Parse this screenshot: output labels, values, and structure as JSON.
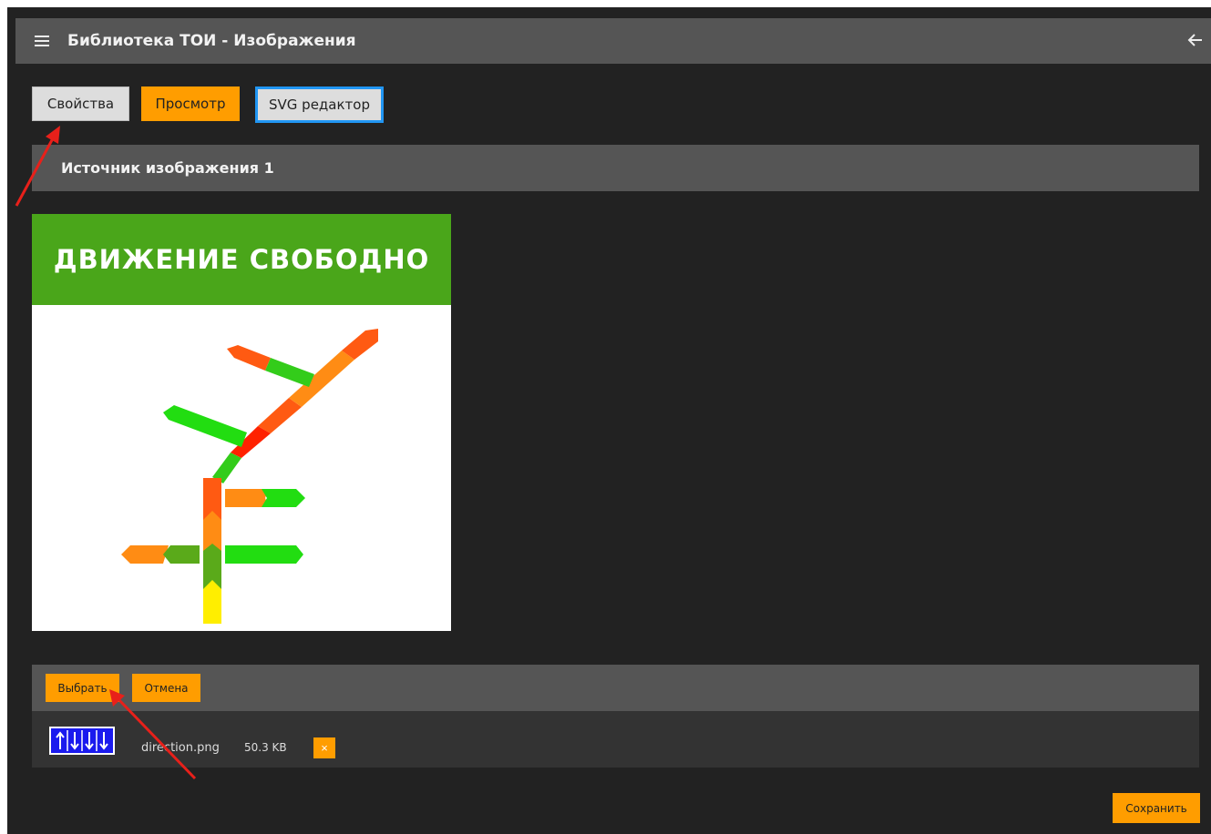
{
  "header": {
    "title": "Библиотека ТОИ - Изображения",
    "menu_icon": "hamburger-menu-icon",
    "back_icon": "arrow-left-icon"
  },
  "tabs": {
    "properties": "Свойства",
    "preview": "Просмотр",
    "svg_editor": "SVG редактор"
  },
  "section": {
    "title": "Источник изображения 1"
  },
  "image": {
    "banner_text": "ДВИЖЕНИЕ СВОБОДНО",
    "banner_color": "#4aa61a"
  },
  "upload": {
    "choose_label": "Выбрать",
    "cancel_label": "Отмена",
    "file_name": "direction.png",
    "file_size": "50.3 KB",
    "remove_label": "×"
  },
  "footer": {
    "save_label": "Сохранить"
  },
  "colors": {
    "accent": "#ff9d00",
    "bar": "#555555",
    "background": "#222222",
    "focus_border": "#2196f3",
    "annotation_arrow": "#e8201a"
  }
}
